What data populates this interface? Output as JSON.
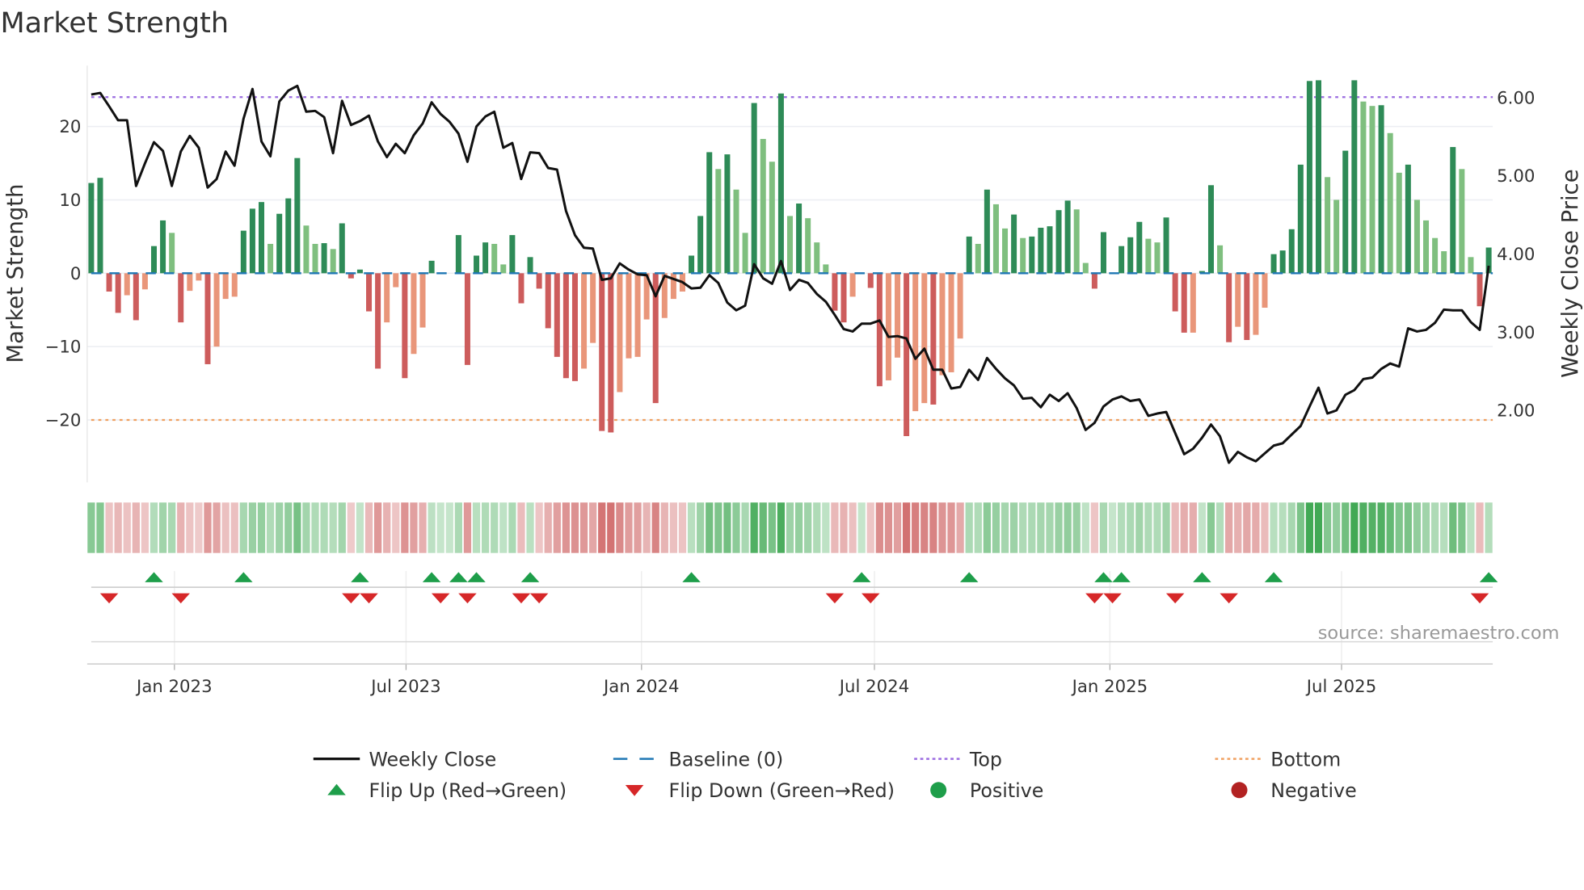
{
  "chart_data": {
    "type": "bar+line",
    "title": "Market Strength",
    "ylabel_left": "Market Strength",
    "ylabel_right": "Weekly Close Price",
    "source": "source: sharemaestro.com",
    "start_week": "2022-10-28",
    "frequency": "weekly",
    "ylim_left": [
      -28.5,
      28.3
    ],
    "ylim_right": [
      1.08,
      6.41
    ],
    "yticks_left": [
      {
        "v": 20,
        "label": "20"
      },
      {
        "v": 10,
        "label": "10"
      },
      {
        "v": 0,
        "label": "0"
      },
      {
        "v": -10,
        "label": "−10"
      },
      {
        "v": -20,
        "label": "−20"
      }
    ],
    "yticks_right": [
      {
        "v": 6,
        "label": "6.00"
      },
      {
        "v": 5,
        "label": "5.00"
      },
      {
        "v": 4,
        "label": "4.00"
      },
      {
        "v": 3,
        "label": "3.00"
      },
      {
        "v": 2,
        "label": "2.00"
      }
    ],
    "xticks": [
      {
        "date": "2023-01-01",
        "label": "Jan 2023"
      },
      {
        "date": "2023-07-01",
        "label": "Jul 2023"
      },
      {
        "date": "2024-01-01",
        "label": "Jan 2024"
      },
      {
        "date": "2024-07-01",
        "label": "Jul 2024"
      },
      {
        "date": "2025-01-01",
        "label": "Jan 2025"
      },
      {
        "date": "2025-07-01",
        "label": "Jul 2025"
      }
    ],
    "top_level": 24,
    "bottom_level": -20,
    "baseline": 0,
    "strength": [
      12.3,
      13,
      -2.5,
      -5.4,
      -3,
      -6.4,
      -2.2,
      3.7,
      7.2,
      5.5,
      -6.7,
      -2.4,
      -1,
      -12.4,
      -10,
      -3.5,
      -3.2,
      5.8,
      8.8,
      9.7,
      4,
      8.1,
      10.2,
      15.7,
      6.5,
      4,
      4.1,
      3.3,
      6.8,
      -0.7,
      0.5,
      -5.2,
      -13,
      -6.7,
      -1.9,
      -14.3,
      -11,
      -7.4,
      1.7,
      0,
      0,
      5.2,
      -12.5,
      2.4,
      4.2,
      4,
      1.2,
      5.2,
      -4.1,
      2.2,
      -2.1,
      -7.5,
      -11.4,
      -14.3,
      -14.7,
      -13,
      -9.5,
      -21.5,
      -21.7,
      -16.2,
      -11.6,
      -11.4,
      -6.3,
      -17.7,
      -6.1,
      -3.5,
      -2.5,
      2.4,
      7.8,
      16.5,
      14.2,
      16.2,
      11.4,
      5.5,
      23.2,
      18.3,
      15.2,
      24.5,
      7.8,
      9.5,
      7.5,
      4.2,
      1.2,
      -5.1,
      -6.7,
      -3.2,
      0,
      -2,
      -15.4,
      -14.6,
      -11.5,
      -22.2,
      -18.8,
      -17.7,
      -17.9,
      -13.9,
      -13.5,
      -8.9,
      5,
      4,
      11.4,
      9.4,
      6.1,
      8,
      4.8,
      5,
      6.2,
      6.4,
      8.6,
      9.9,
      8.7,
      1.4,
      -2.1,
      5.6,
      0,
      3.7,
      4.9,
      7,
      4.7,
      4.2,
      7.6,
      -5.2,
      -8.1,
      -8.1,
      0.3,
      12,
      3.8,
      -9.4,
      -7.3,
      -9.1,
      -8.4,
      -4.7,
      2.6,
      3.1,
      6,
      14.8,
      26.2,
      26.3,
      13.1,
      10,
      16.7,
      26.3,
      23.4,
      22.8,
      22.9,
      19.1,
      13.7,
      14.8,
      10,
      7.2,
      4.8,
      3,
      17.2,
      14.2,
      2.2,
      -4.5,
      3.5
    ],
    "shade": "DDRRSRSDDLRSSRSSSDDDLDDDLLDLDRDRRSSRSSDDDDRDDLLDRDRRRRRSSRRSSSSRSSSDDDLDLLDLLDLDLLLRRSDRRSSRSSRSSSDLDLLDLDDDDDLLRDDDDDLLDRRSDDLRSRSSDDDDDDLLDDLLDLLDLLLLDLLRD",
    "weekly_close": [
      6.04,
      6.06,
      5.89,
      5.71,
      5.71,
      4.87,
      5.16,
      5.43,
      5.32,
      4.87,
      5.31,
      5.51,
      5.36,
      4.85,
      4.96,
      5.31,
      5.13,
      5.73,
      6.11,
      5.44,
      5.25,
      5.95,
      6.09,
      6.15,
      5.82,
      5.83,
      5.75,
      5.29,
      5.96,
      5.65,
      5.7,
      5.77,
      5.44,
      5.24,
      5.41,
      5.29,
      5.52,
      5.67,
      5.94,
      5.79,
      5.69,
      5.54,
      5.18,
      5.63,
      5.76,
      5.82,
      5.36,
      5.42,
      4.96,
      5.3,
      5.29,
      5.1,
      5.08,
      4.55,
      4.24,
      4.08,
      4.07,
      3.67,
      3.69,
      3.88,
      3.8,
      3.74,
      3.73,
      3.46,
      3.72,
      3.68,
      3.64,
      3.56,
      3.57,
      3.73,
      3.63,
      3.38,
      3.28,
      3.34,
      3.87,
      3.69,
      3.62,
      3.91,
      3.54,
      3.67,
      3.63,
      3.49,
      3.39,
      3.22,
      3.04,
      3.01,
      3.11,
      3.11,
      3.15,
      2.94,
      2.95,
      2.92,
      2.66,
      2.79,
      2.52,
      2.52,
      2.28,
      2.3,
      2.52,
      2.39,
      2.67,
      2.53,
      2.41,
      2.32,
      2.15,
      2.16,
      2.04,
      2.2,
      2.12,
      2.22,
      2.03,
      1.75,
      1.84,
      2.05,
      2.14,
      2.18,
      2.12,
      2.14,
      1.93,
      1.96,
      1.98,
      1.71,
      1.44,
      1.51,
      1.65,
      1.82,
      1.67,
      1.33,
      1.47,
      1.4,
      1.35,
      1.45,
      1.55,
      1.58,
      1.69,
      1.8,
      2.05,
      2.29,
      1.96,
      2,
      2.2,
      2.26,
      2.4,
      2.42,
      2.53,
      2.6,
      2.56,
      3.05,
      3.01,
      3.03,
      3.12,
      3.29,
      3.28,
      3.28,
      3.13,
      3.03,
      3.85
    ],
    "flip_up_weeks": [
      7,
      17,
      30,
      38,
      41,
      43,
      49,
      67,
      86,
      98,
      113,
      115,
      124,
      132,
      156
    ],
    "flip_down_weeks": [
      2,
      10,
      29,
      31,
      39,
      42,
      48,
      50,
      83,
      87,
      112,
      114,
      121,
      127,
      155
    ],
    "legend": {
      "placement": "bottom",
      "items": [
        {
          "label": "Weekly Close",
          "marker": "line",
          "color": "#111111"
        },
        {
          "label": "Baseline (0)",
          "marker": "dashed",
          "color": "#1f77b4"
        },
        {
          "label": "Top",
          "marker": "dotted",
          "color": "#9b6be0"
        },
        {
          "label": "Bottom",
          "marker": "dotted",
          "color": "#f0a060"
        },
        {
          "label": "Flip Up (Red→Green)",
          "marker": "triangle-up",
          "color": "#1e9e4a"
        },
        {
          "label": "Flip Down (Green→Red)",
          "marker": "triangle-down",
          "color": "#d62728"
        },
        {
          "label": "Positive",
          "marker": "circle",
          "color": "#1e9e4a"
        },
        {
          "label": "Negative",
          "marker": "circle",
          "color": "#b22222"
        }
      ]
    },
    "colors": {
      "strong_up": "#2e8b57",
      "weak_up": "#7fbf7f",
      "strong_down": "#cd5c5c",
      "weak_down": "#e9967a",
      "heat_pos": "#2ea043",
      "heat_neg": "#c85050"
    }
  }
}
